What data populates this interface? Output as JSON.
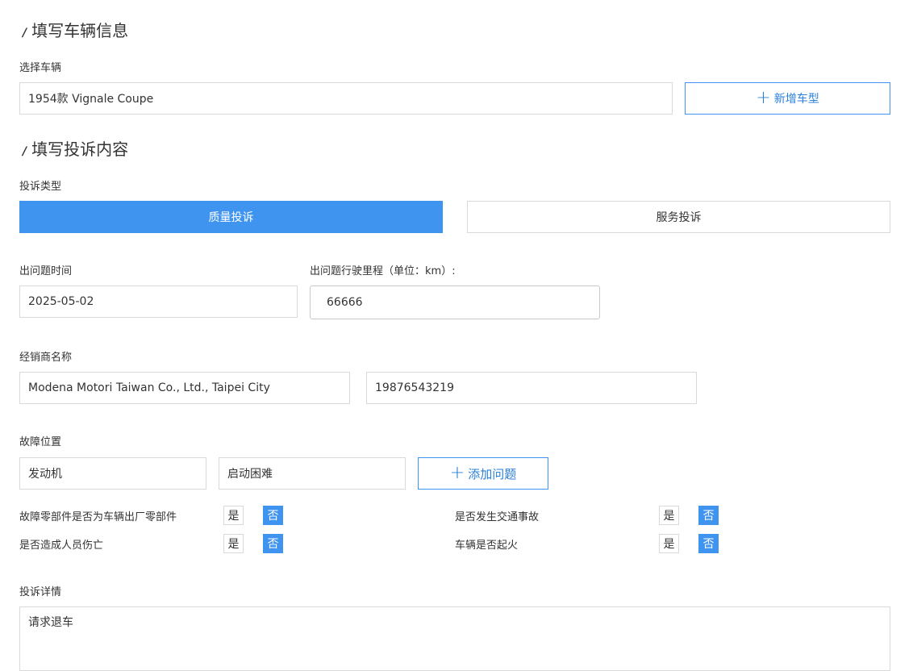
{
  "section_vehicle": {
    "title": "填写车辆信息",
    "mark": "/"
  },
  "vehicle": {
    "label": "选择车辆",
    "value": "1954款 Vignale Coupe",
    "add_button": "新增车型",
    "plus": "+"
  },
  "section_complaint": {
    "title": "填写投诉内容",
    "mark": "/"
  },
  "complaint_type": {
    "label": "投诉类型",
    "options": [
      "质量投诉",
      "服务投诉"
    ],
    "selected": "质量投诉"
  },
  "problem_time": {
    "label": "出问题时间",
    "value": "2025-05-02"
  },
  "mileage": {
    "label": "出问题行驶里程（单位：km）:",
    "value": "66666"
  },
  "dealer": {
    "label": "经销商名称",
    "name": "Modena Motori Taiwan Co., Ltd., Taipei City",
    "phone": "19876543219"
  },
  "fault": {
    "label": "故障位置",
    "location": "发动机",
    "problem": "启动困难",
    "add_button": "添加问题",
    "plus": "+"
  },
  "questions": [
    {
      "text": "故障零部件是否为车辆出厂零部件",
      "yes": "是",
      "no": "否",
      "selected": "否"
    },
    {
      "text": "是否发生交通事故",
      "yes": "是",
      "no": "否",
      "selected": "否"
    },
    {
      "text": "是否造成人员伤亡",
      "yes": "是",
      "no": "否",
      "selected": "否"
    },
    {
      "text": "车辆是否起火",
      "yes": "是",
      "no": "否",
      "selected": "否"
    }
  ],
  "details": {
    "label": "投诉详情",
    "value": "请求退车"
  },
  "colors": {
    "accent": "#3f94ef",
    "border": "#d9d9d9",
    "text": "#333333"
  }
}
